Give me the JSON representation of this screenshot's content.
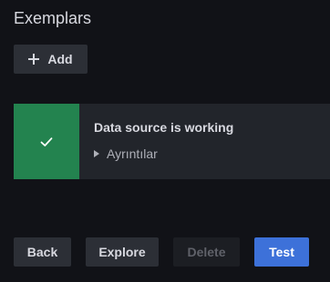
{
  "exemplars": {
    "title": "Exemplars",
    "add_label": "Add"
  },
  "alert": {
    "status": "success",
    "color": "#23834f",
    "icon": "check-icon",
    "title": "Data source is working",
    "details_label": "Ayrıntılar"
  },
  "actions": {
    "back_label": "Back",
    "explore_label": "Explore",
    "delete_label": "Delete",
    "test_label": "Test",
    "primary_color": "#3d71d9"
  }
}
